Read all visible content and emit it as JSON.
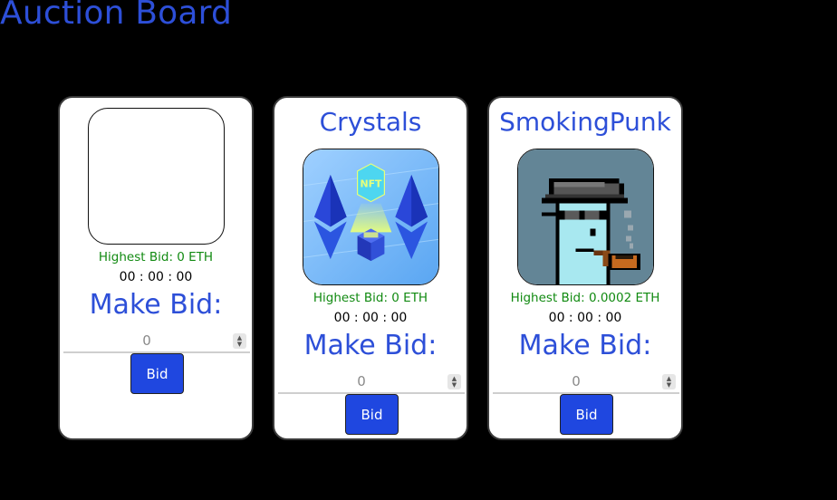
{
  "page": {
    "title": "Auction Board"
  },
  "cards": [
    {
      "name": "",
      "image": "blank-image",
      "highest_bid": "Highest Bid: 0 ETH",
      "timer": "00 : 00 : 00",
      "make_bid": "Make Bid:",
      "bid_value": "0",
      "bid_button": "Bid"
    },
    {
      "name": "Crystals",
      "image": "ethereum-crystals-nft-image",
      "highest_bid": "Highest Bid: 0 ETH",
      "timer": "00 : 00 : 00",
      "make_bid": "Make Bid:",
      "bid_value": "0",
      "bid_button": "Bid"
    },
    {
      "name": "SmokingPunk",
      "image": "pixel-punk-smoking-pipe-image",
      "highest_bid": "Highest Bid: 0.0002 ETH",
      "timer": "00 : 00 : 00",
      "make_bid": "Make Bid:",
      "bid_value": "0",
      "bid_button": "Bid"
    }
  ],
  "colors": {
    "background": "#000000",
    "accent": "#2d4fd8",
    "bid_text": "#118a11",
    "button": "#1f47e0"
  }
}
